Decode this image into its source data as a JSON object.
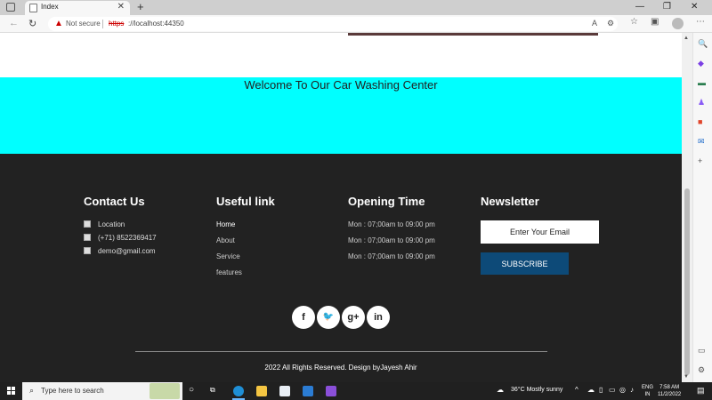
{
  "browser": {
    "tab_title": "Index",
    "tab_close": "✕",
    "new_tab": "+",
    "window_controls": [
      "—",
      "❐",
      "✕"
    ],
    "security_label": "Not secure",
    "url_scheme": "https",
    "url_rest": "://localhost:44350",
    "icons": [
      "back-icon",
      "refresh-icon",
      "read-aloud-icon",
      "tracking-icon",
      "favorites-icon",
      "collections-icon",
      "profile-icon",
      "more-icon"
    ]
  },
  "page": {
    "welcome": "Welcome To Our Car Washing Center",
    "accent_color": "#00ffff",
    "footer_bg": "#222222"
  },
  "contact": {
    "heading": "Contact Us",
    "items": [
      "Location",
      "(+71) 8522369417",
      "demo@gmail.com"
    ]
  },
  "links": {
    "heading": "Useful link",
    "items": [
      "Home",
      "About",
      "Service",
      "features"
    ]
  },
  "hours": {
    "heading": "Opening Time",
    "items": [
      "Mon : 07;00am to 09:00 pm",
      "Mon : 07;00am to 09:00 pm",
      "Mon : 07;00am to 09:00 pm"
    ]
  },
  "newsletter": {
    "heading": "Newsletter",
    "placeholder": "Enter Your Email",
    "button": "SUBSCRIBE",
    "button_color": "#0d4a78"
  },
  "social": [
    {
      "name": "facebook-icon",
      "glyph": "f"
    },
    {
      "name": "twitter-icon",
      "glyph": "🐦"
    },
    {
      "name": "google-plus-icon",
      "glyph": "g+"
    },
    {
      "name": "linkedin-icon",
      "glyph": "in"
    }
  ],
  "copyright": "2022 All Rights Reserved. Design byJayesh Ahir",
  "taskbar": {
    "search_placeholder": "Type here to search",
    "weather": "36°C  Mostly sunny",
    "lang_line1": "ENG",
    "lang_line2": "IN",
    "time": "7:58 AM",
    "date": "11/2/2022"
  }
}
